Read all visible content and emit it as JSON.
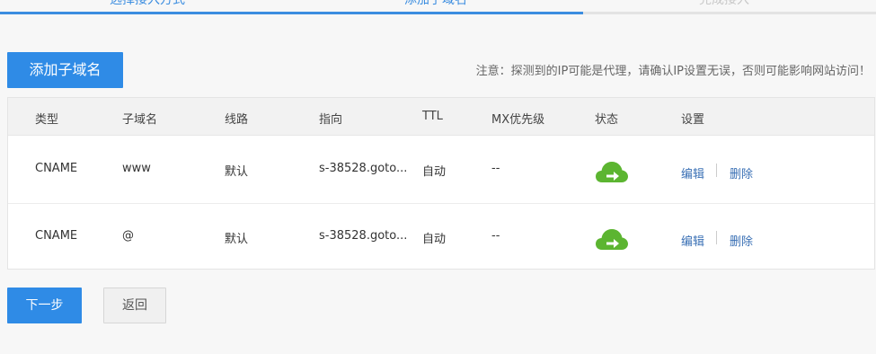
{
  "stepper": {
    "steps": [
      {
        "label": "选择接入方式",
        "state": "done"
      },
      {
        "label": "添加子域名",
        "state": "current"
      },
      {
        "label": "完成接入",
        "state": "todo"
      }
    ],
    "accent_color": "#3b8de0",
    "inactive_color": "#e3e3e3"
  },
  "toolbar": {
    "add_label": "添加子域名",
    "notice": "注意：探测到的IP可能是代理，请确认IP设置无误，否则可能影响网站访问！"
  },
  "table": {
    "headers": {
      "type": "类型",
      "subdomain": "子域名",
      "line": "线路",
      "target": "指向",
      "ttl": "TTL",
      "mx": "MX优先级",
      "status": "状态",
      "settings": "设置"
    },
    "rows": [
      {
        "type": "CNAME",
        "subdomain": "www",
        "line": "默认",
        "target": "s-38528.goto...",
        "ttl": "自动",
        "mx": "--",
        "status_icon": "cloud-arrow-icon",
        "edit": "编辑",
        "delete": "删除"
      },
      {
        "type": "CNAME",
        "subdomain": "@",
        "line": "默认",
        "target": "s-38528.goto...",
        "ttl": "自动",
        "mx": "--",
        "status_icon": "cloud-arrow-icon",
        "edit": "编辑",
        "delete": "删除"
      }
    ],
    "status_color": "#5cb531",
    "link_color": "#3a70b5"
  },
  "footer": {
    "next_label": "下一步",
    "back_label": "返回"
  }
}
